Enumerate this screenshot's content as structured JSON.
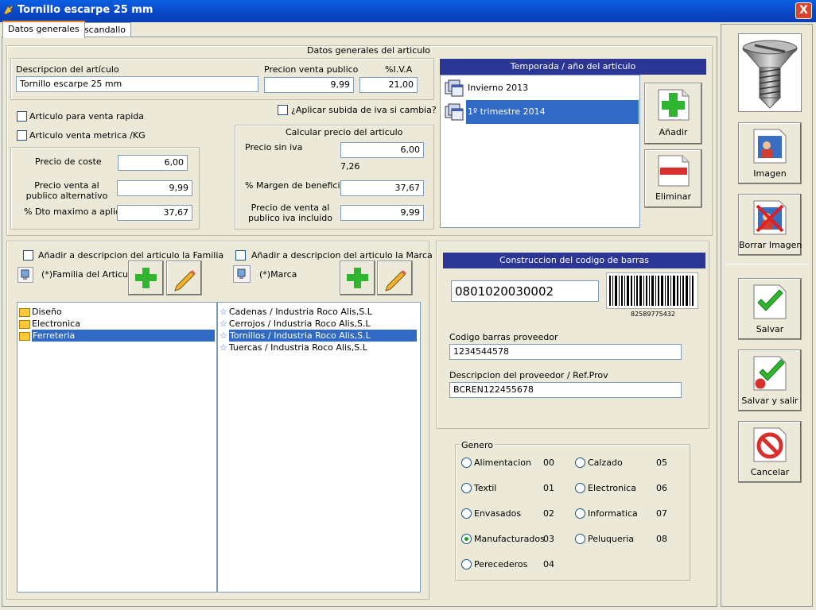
{
  "window": {
    "title": "Tornillo escarpe 25 mm",
    "close_label": "X"
  },
  "tabs": [
    {
      "label": "Datos generales",
      "active": true
    },
    {
      "label": "Escandallo",
      "active": false
    }
  ],
  "general": {
    "section_title": "Datos generales del articulo",
    "description_label": "Descripcion del artículo",
    "description_value": "Tornillo escarpe 25 mm",
    "price_label": "Precion venta publico",
    "price_value": "9,99",
    "iva_label": "%I.V.A",
    "iva_value": "21,00",
    "quick_sale_label": "Articulo para venta rapida",
    "metric_sale_label": "Articulo venta metrica /KG",
    "apply_iva_label": "¿Aplicar subida de iva si cambia?",
    "cost_label": "Precio de coste",
    "cost_value": "6,00",
    "alt_price_label": "Precio venta al publico alternativo",
    "alt_price_value": "9,99",
    "max_discount_label": "% Dto maximo a aplicar:",
    "max_discount_value": "37,67"
  },
  "calc": {
    "title": "Calcular precio del articulo",
    "price_no_iva_label": "Precio sin iva",
    "price_no_iva_value": "6,00",
    "extra_value": "7,26",
    "margin_label": "% Margen de beneficio",
    "margin_value": "37,67",
    "public_price_label": "Precio de venta al publico iva incluido",
    "public_price_value": "9,99"
  },
  "season": {
    "title": "Temporada / año del articulo",
    "items": [
      {
        "label": "Invierno 2013",
        "selected": false
      },
      {
        "label": "1º trimestre 2014",
        "selected": true
      }
    ],
    "add_label": "Añadir",
    "delete_label": "Eliminar"
  },
  "family": {
    "add_to_desc_label": "Añadir a descripcion del articulo la Familia",
    "family_label": "(*)Familia del Articulo",
    "items": [
      {
        "label": "Diseño",
        "selected": false
      },
      {
        "label": "Electronica",
        "selected": false
      },
      {
        "label": "Ferreteria",
        "selected": true
      }
    ]
  },
  "brand": {
    "add_to_desc_label": "Añadir a descripcion del articulo la Marca",
    "brand_label": "(*)Marca",
    "items": [
      {
        "label": "Cadenas / Industria Roco Alis,S.L",
        "selected": false
      },
      {
        "label": "Cerrojos / Industria Roco Alis,S.L",
        "selected": false
      },
      {
        "label": "Tornillos / Industria Roco Alis,S.L",
        "selected": true
      },
      {
        "label": "Tuercas / Industria Roco Alis,S.L",
        "selected": false
      }
    ]
  },
  "barcode": {
    "title": "Construccion del codigo de barras",
    "code_value": "0801020030002",
    "barcode_number": "82589775432",
    "supplier_code_label": "Codigo barras proveedor",
    "supplier_code_value": "1234544578",
    "supplier_desc_label": "Descripcion del proveedor / Ref.Prov",
    "supplier_desc_value": "BCREN122455678"
  },
  "genero": {
    "title": "Genero",
    "options": [
      {
        "label": "Alimentacion",
        "code": "00",
        "checked": false
      },
      {
        "label": "Textil",
        "code": "01",
        "checked": false
      },
      {
        "label": "Envasados",
        "code": "02",
        "checked": false
      },
      {
        "label": "Manufacturados",
        "code": "03",
        "checked": true
      },
      {
        "label": "Perecederos",
        "code": "04",
        "checked": false
      },
      {
        "label": "Calzado",
        "code": "05",
        "checked": false
      },
      {
        "label": "Electronica",
        "code": "06",
        "checked": false
      },
      {
        "label": "Informatica",
        "code": "07",
        "checked": false
      },
      {
        "label": "Peluqueria",
        "code": "08",
        "checked": false
      }
    ]
  },
  "sidebar": {
    "image_label": "Imagen",
    "delete_image_label": "Borrar Imagen",
    "save_label": "Salvar",
    "save_exit_label": "Salvar y salir",
    "cancel_label": "Cancelar"
  },
  "colors": {
    "titlebar": "#0a4fd3",
    "header_bar": "#2c3695",
    "selection": "#316ac5",
    "add_green": "#2fb52f",
    "delete_red": "#d8302c"
  }
}
